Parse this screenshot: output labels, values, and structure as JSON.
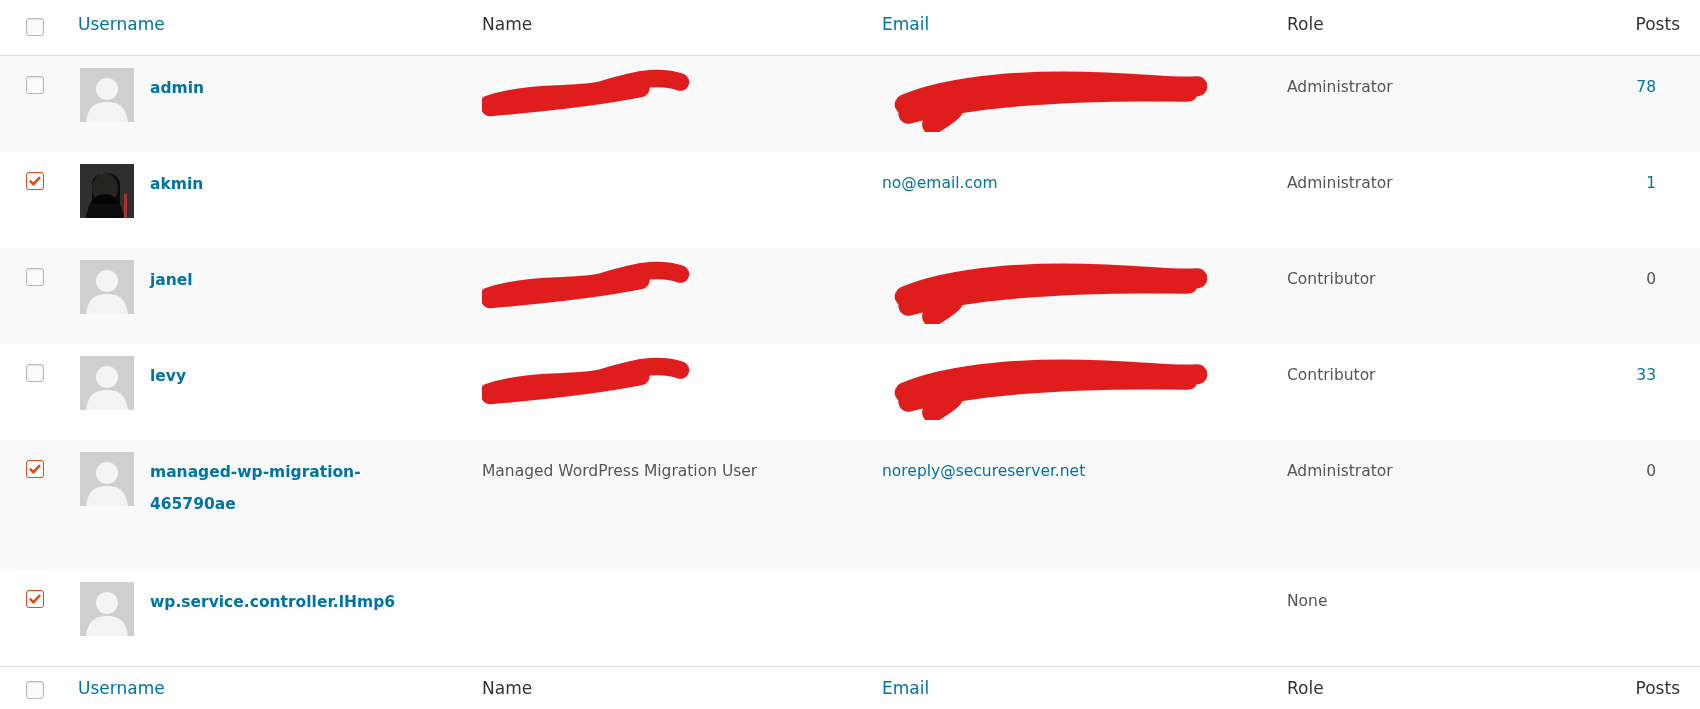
{
  "header": {
    "checked": false,
    "columns": [
      "Username",
      "Name",
      "Email",
      "Role",
      "Posts"
    ]
  },
  "rows": [
    {
      "checked": false,
      "has_photo": false,
      "username": "admin",
      "name_redacted": true,
      "email_redacted": true,
      "role": "Administrator",
      "posts": "78",
      "posts_linked": true
    },
    {
      "checked": true,
      "has_photo": true,
      "username": "akmin",
      "name_redacted": false,
      "email": "no@email.com",
      "email_redacted": false,
      "role": "Administrator",
      "posts": "1",
      "posts_linked": true
    },
    {
      "checked": false,
      "has_photo": false,
      "username": "janel",
      "name_redacted": true,
      "email_redacted": true,
      "role": "Contributor",
      "posts": "0",
      "posts_linked": false
    },
    {
      "checked": false,
      "has_photo": false,
      "username": "levy",
      "name_redacted": true,
      "email_redacted": true,
      "role": "Contributor",
      "posts": "33",
      "posts_linked": true
    },
    {
      "checked": true,
      "has_photo": false,
      "username": "managed-wp-migration-465790ae",
      "name": "Managed WordPress Migration User",
      "name_redacted": false,
      "email": "noreply@secureserver.net",
      "email_redacted": false,
      "role": "Administrator",
      "posts": "0",
      "posts_linked": false
    },
    {
      "checked": true,
      "has_photo": false,
      "username": "wp.service.controller.lHmp6",
      "name_redacted": false,
      "email_redacted": false,
      "role": "None"
    }
  ],
  "footer": {
    "checked": false,
    "columns": [
      "Username",
      "Name",
      "Email",
      "Role",
      "Posts"
    ]
  }
}
